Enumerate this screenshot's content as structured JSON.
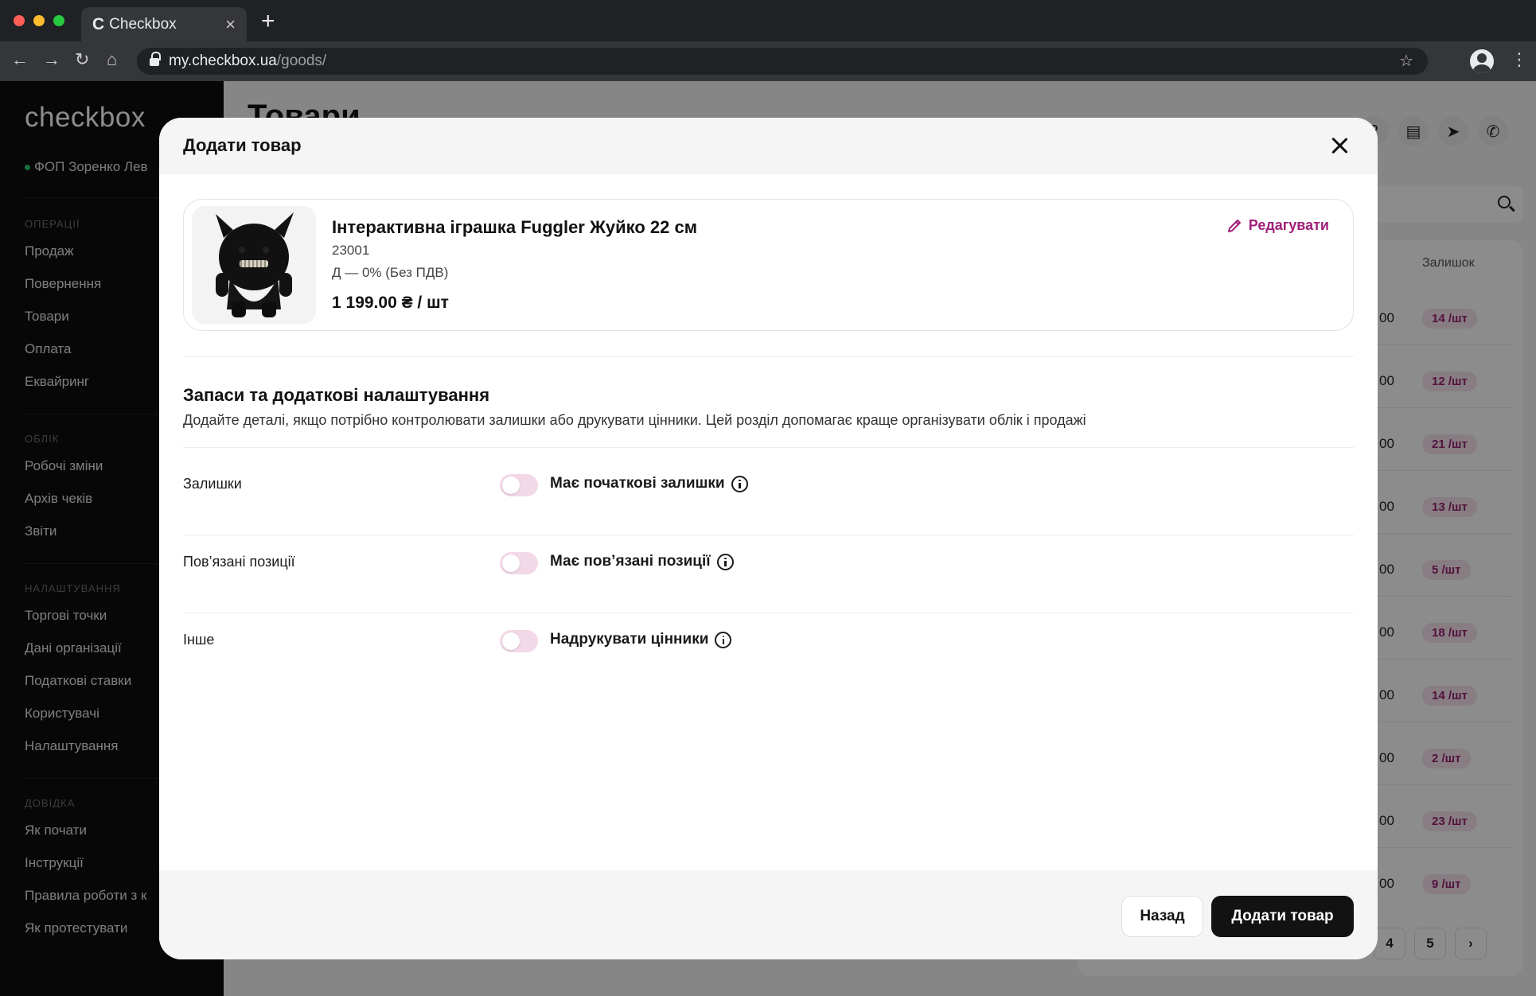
{
  "browser": {
    "tab_title": "Checkbox",
    "tab_logo": "C",
    "url_host": "my.checkbox.ua",
    "url_path": "/goods/"
  },
  "sidebar": {
    "brand": "checkbox",
    "org": "ФОП Зоренко Лев",
    "sections": {
      "operations": "ОПЕРАЦІЇ",
      "accounting": "ОБЛІК",
      "settings": "НАЛАШТУВАННЯ",
      "help": "ДОВІДКА"
    },
    "items": [
      "Продаж",
      "Повернення",
      "Товари",
      "Оплата",
      "Еквайринг",
      "Робочі зміни",
      "Архів чеків",
      "Звіти",
      "Торгові точки",
      "Дані організації",
      "Податкові ставки",
      "Користувачі",
      "Налаштування",
      "Як почати",
      "Інструкції",
      "Правила роботи з к",
      "Як протестувати"
    ]
  },
  "main": {
    "title": "Товари",
    "stock_column": "Залишок",
    "stock_partial": [
      "00",
      "00",
      "00",
      "00",
      "00",
      "00",
      "00",
      "00",
      "00",
      "00"
    ],
    "stock_badges": [
      "14 /шт",
      "12 /шт",
      "21 /шт",
      "13 /шт",
      "5 /шт",
      "18 /шт",
      "14 /шт",
      "2 /шт",
      "23 /шт",
      "9 /шт"
    ],
    "pages": [
      "4",
      "5",
      "›"
    ]
  },
  "modal": {
    "title": "Додати товар",
    "product": {
      "name": "Інтерактивна іграшка Fuggler Жуйко 22 см",
      "code": "23001",
      "tax": "Д — 0% (Без ПДВ)",
      "price": "1 199.00 ₴ / шт",
      "edit_label": "Редагувати"
    },
    "section_title": "Запаси та додаткові налаштування",
    "section_desc": "Додайте деталі, якщо потрібно контролювати залишки або друкувати цінники. Цей розділ допомагає краще організувати облік і продажі",
    "settings": [
      {
        "label": "Залишки",
        "toggle_label": "Має початкові залишки"
      },
      {
        "label": "Пов’язані позиції",
        "toggle_label": "Має пов’язані позиції"
      },
      {
        "label": "Інше",
        "toggle_label": "Надрукувати цінники"
      }
    ],
    "back_label": "Назад",
    "add_label": "Додати товар"
  },
  "colors": {
    "accent": "#a01f7a",
    "toggle_off": "#f3d8e8",
    "primary_button": "#121212"
  }
}
